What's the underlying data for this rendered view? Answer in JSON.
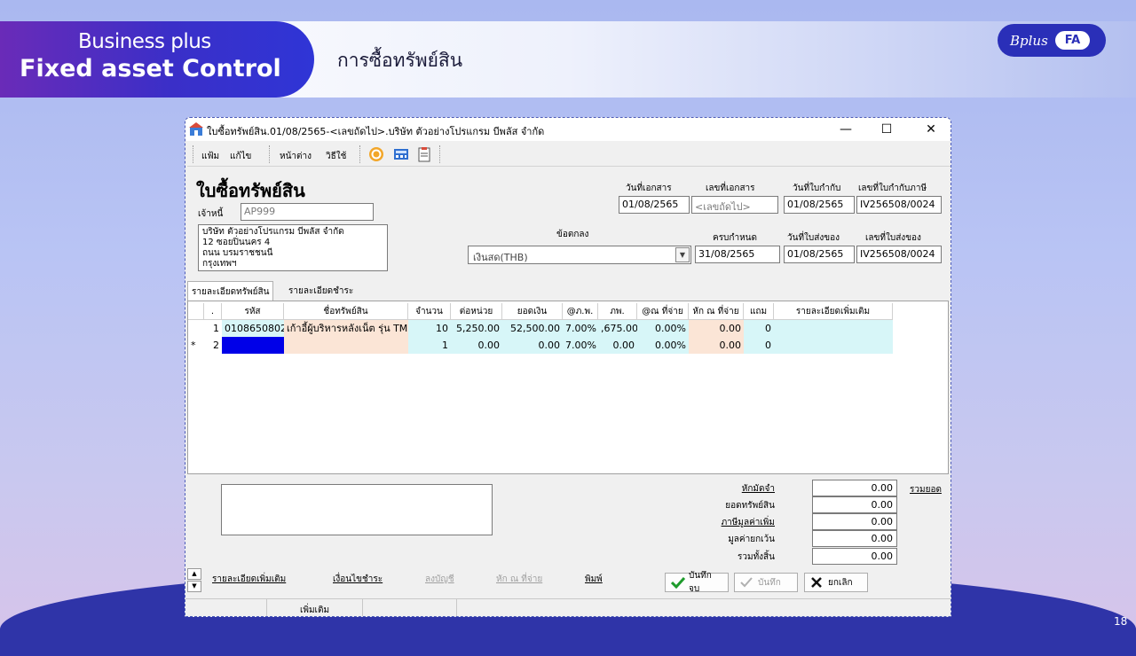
{
  "slide": {
    "brand_line1": "Business plus",
    "brand_line2": "Fixed asset Control",
    "title": "การซื้อทรัพย์สิน",
    "logo_brand": "Bplus",
    "logo_badge": "FA",
    "page_number": "18",
    "colors": {
      "accent": "#2f35d6",
      "brand_purple": "#6a2bb8"
    }
  },
  "window": {
    "title": "ใบซื้อทรัพย์สิน.01/08/2565-<เลขถัดไป>.บริษัท ตัวอย่างโปรแกรม บีพลัส จำกัด",
    "controls": {
      "minimize": "—",
      "maximize": "☐",
      "close": "✕"
    }
  },
  "menu": {
    "file": "แฟ้ม",
    "edit": "แก้ไข",
    "window": "หน้าต่าง",
    "howto": "วิธีใช้"
  },
  "form": {
    "title": "ใบซื้อทรัพย์สิน",
    "creditor_label": "เจ้าหนี้",
    "creditor_value": "AP999",
    "address_lines": [
      "บริษัท ตัวอย่างโปรแกรม บีพลัส จำกัด",
      "12 ซอยปิ่นนคร 4",
      "ถนน บรมราชชนนี",
      "กรุงเทพฯ"
    ],
    "terms_label": "ข้อตกลง",
    "terms_value": "เงินสด(THB)",
    "doc_date_label": "วันที่เอกสาร",
    "doc_date_value": "01/08/2565",
    "doc_no_label": "เลขที่เอกสาร",
    "doc_no_value": "<เลขถัดไป>",
    "invoice_date_label": "วันที่ใบกำกับ",
    "invoice_date_value": "01/08/2565",
    "tax_invoice_no_label": "เลขที่ใบกำกับภาษี",
    "tax_invoice_no_value": "IV256508/0024",
    "due_label": "ครบกำหนด",
    "due_value": "31/08/2565",
    "delivery_date_label": "วันที่ใบส่งของ",
    "delivery_date_value": "01/08/2565",
    "delivery_no_label": "เลขที่ใบส่งของ",
    "delivery_no_value": "IV256508/0024"
  },
  "tabs": {
    "asset_detail": "รายละเอียดทรัพย์สิน",
    "payment_detail": "รายละเอียดชำระ"
  },
  "grid": {
    "headers": [
      ".",
      "รหัส",
      "ชื่อทรัพย์สิน",
      "จำนวน",
      "ต่อหน่วย",
      "ยอดเงิน",
      "@ภ.พ.",
      "ภพ.",
      "@ณ ที่จ่าย",
      "หัก ณ ที่จ่าย",
      "แถม",
      "รายละเอียดเพิ่มเติม"
    ],
    "rows": [
      {
        "marker": "",
        "idx": "1",
        "code": "0108650802",
        "name": "เก้าอี้ผู้บริหารหลังเน็ต รุ่น TM",
        "qty": "10",
        "unit": "5,250.00",
        "amount": "52,500.00",
        "vat_rate": "7.00%",
        "vat": ",675.00",
        "wht_rate": "0.00%",
        "wht": "0.00",
        "free": "0",
        "note": ""
      },
      {
        "marker": "*",
        "idx": "2",
        "code": "",
        "name": "",
        "qty": "1",
        "unit": "0.00",
        "amount": "0.00",
        "vat_rate": "7.00%",
        "vat": "0.00",
        "wht_rate": "0.00%",
        "wht": "0.00",
        "free": "0",
        "note": ""
      }
    ]
  },
  "summary": {
    "deposit_label": "หักมัดจำ",
    "deposit_value": "0.00",
    "asset_total_label": "ยอดทรัพย์สิน",
    "asset_total_value": "0.00",
    "vat_label": "ภาษีมูลค่าเพิ่ม",
    "vat_value": "0.00",
    "exempt_label": "มูลค่ายกเว้น",
    "exempt_value": "0.00",
    "grand_total_label": "รวมทั้งสิ้น",
    "grand_total_value": "0.00",
    "sum_link": "รวมยอด"
  },
  "actions": {
    "more_detail": "รายละเอียดเพิ่มเติม",
    "payment_terms": "เงื่อนไขชำระ",
    "post_ledger": "ลงบัญชี",
    "withholding": "หัก ณ ที่จ่าย",
    "print": "พิมพ์",
    "save_close": "บันทึกจบ",
    "save": "บันทึก",
    "cancel": "ยกเลิก"
  },
  "status": {
    "mode": "เพิ่มเติม"
  }
}
